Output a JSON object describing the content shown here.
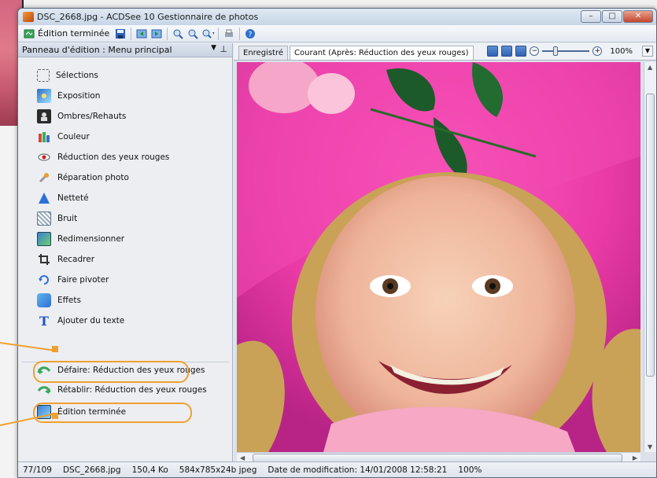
{
  "window": {
    "title": "DSC_2668.jpg - ACDSee 10 Gestionnaire de photos",
    "minimize": "–",
    "maximize": "□",
    "close": "✕"
  },
  "toolbar": {
    "edition_terminee": "Édition terminée"
  },
  "panel": {
    "header": "Panneau d'édition : Menu principal",
    "dropdown": "▼",
    "pin": "⊥",
    "items": [
      {
        "label": "Sélections",
        "icon": "selection-icon"
      },
      {
        "label": "Exposition",
        "icon": "exposure-icon"
      },
      {
        "label": "Ombres/Rehauts",
        "icon": "shadows-icon"
      },
      {
        "label": "Couleur",
        "icon": "color-icon"
      },
      {
        "label": "Réduction des yeux rouges",
        "icon": "red-eye-icon"
      },
      {
        "label": "Réparation photo",
        "icon": "repair-icon"
      },
      {
        "label": "Netteté",
        "icon": "sharpness-icon"
      },
      {
        "label": "Bruit",
        "icon": "noise-icon"
      },
      {
        "label": "Redimensionner",
        "icon": "resize-icon"
      },
      {
        "label": "Recadrer",
        "icon": "crop-icon"
      },
      {
        "label": "Faire pivoter",
        "icon": "rotate-icon"
      },
      {
        "label": "Effets",
        "icon": "effects-icon"
      },
      {
        "label": "Ajouter du texte",
        "icon": "text-icon"
      }
    ],
    "undo": "Défaire: Réduction des yeux rouges",
    "redo": "Rétablir: Réduction des yeux rouges",
    "done": "Édition terminée"
  },
  "image_area": {
    "tabs": [
      "Enregistré",
      "Courant (Après: Réduction des yeux rouges)"
    ],
    "active_tab": 1,
    "zoom": "100%",
    "zoom_minus": "−",
    "zoom_plus": "+"
  },
  "statusbar": {
    "position": "77/109",
    "filename": "DSC_2668.jpg",
    "size": "150,4 Ko",
    "dims": "584x785x24b jpeg",
    "modified": "Date de modification: 14/01/2008 12:58:21",
    "zoom": "100%"
  }
}
